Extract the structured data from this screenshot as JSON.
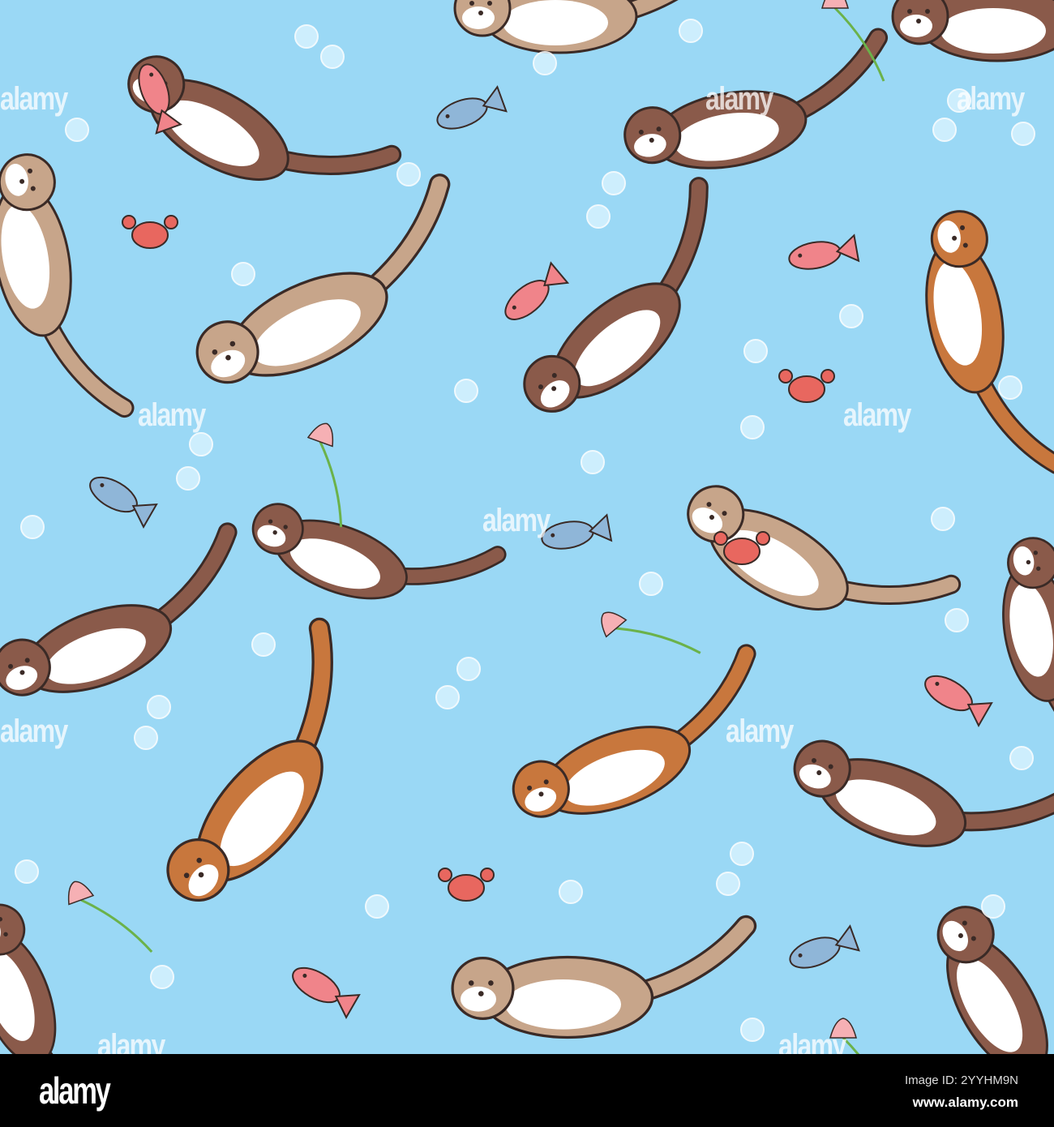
{
  "illustration": {
    "subject": "Seamless pattern of cartoon otters swimming with fish, crabs, bubbles and lotus flowers",
    "watermark_text": "alamy",
    "colors": {
      "water": "#9ad8f5",
      "otter_dark": "#8a5a4a",
      "otter_light": "#c7a58a",
      "otter_orange": "#c8773d",
      "belly": "#ffffff",
      "crab": "#e8675f",
      "fish_blue": "#8fb6d8",
      "fish_pink": "#f0848a",
      "bubble": "#d6f2ff",
      "outline": "#3a2a26"
    }
  },
  "footer": {
    "logo": "alamy",
    "image_id": "Image ID: 2YYHM9N",
    "website": "www.alamy.com"
  }
}
